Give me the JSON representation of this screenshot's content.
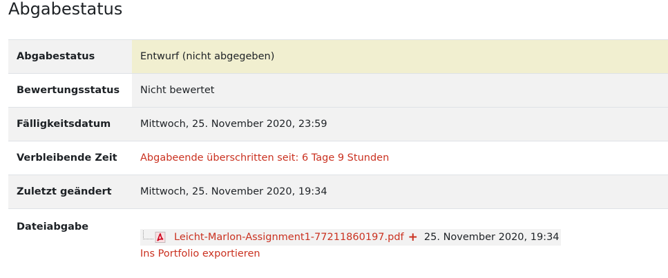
{
  "page_title": "Abgabestatus",
  "rows": [
    {
      "label": "Abgabestatus",
      "value": "Entwurf (nicht abgegeben)"
    },
    {
      "label": "Bewertungsstatus",
      "value": "Nicht bewertet"
    },
    {
      "label": "Fälligkeitsdatum",
      "value": "Mittwoch, 25. November 2020, 23:59"
    },
    {
      "label": "Verbleibende Zeit",
      "value": "Abgabeende überschritten seit: 6 Tage 9 Stunden"
    },
    {
      "label": "Zuletzt geändert",
      "value": "Mittwoch, 25. November 2020, 19:34"
    },
    {
      "label": "Dateiabgabe"
    }
  ],
  "file_submission": {
    "file_name": "Leicht-Marlon-Assignment1-77211860197.pdf",
    "file_icon": "pdf-icon",
    "plus_icon": "+",
    "file_date": "25. November 2020, 19:34",
    "portfolio_link": "Ins Portfolio exportieren"
  },
  "colors": {
    "accent_red": "#ca3120",
    "highlight_yellow": "#f1efd0",
    "row_grey": "#f2f2f2"
  }
}
